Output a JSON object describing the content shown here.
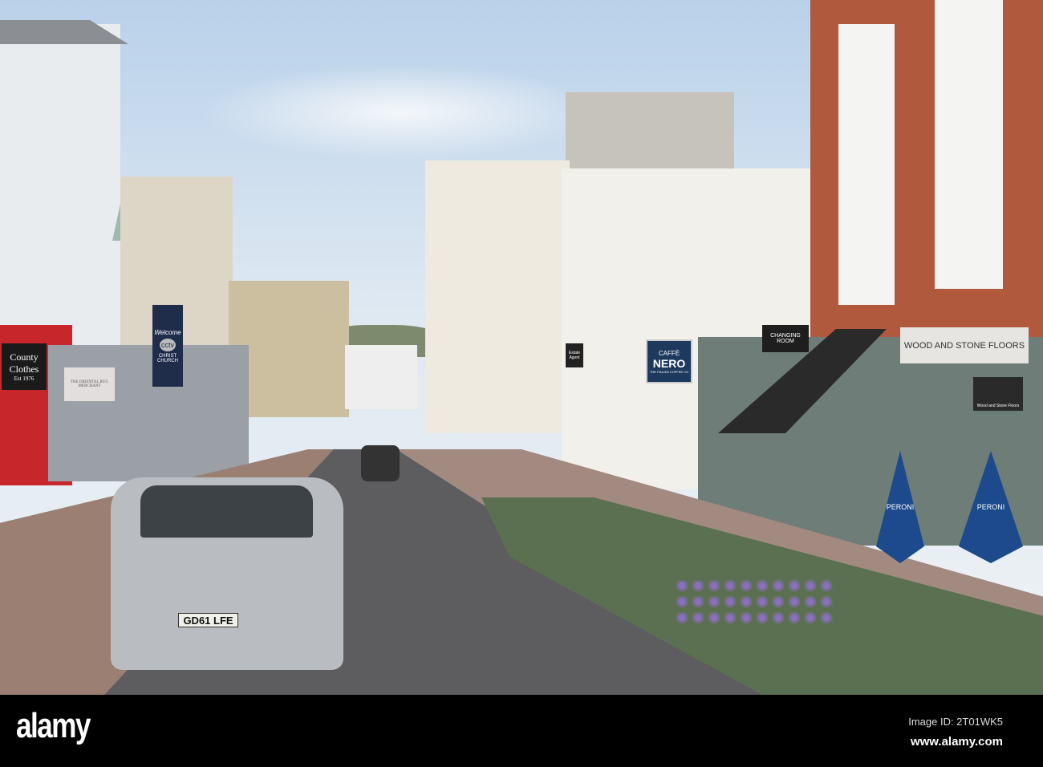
{
  "signs": {
    "county_clothes": [
      "County",
      "Clothes",
      "Est 1976"
    ],
    "banner": [
      "Welcome",
      "cctv",
      "CHRIST",
      "CHURCH"
    ],
    "rug_merchant": "THE ORIENTAL RUG MERCHANT",
    "caffe_nero": [
      "CAFFÈ",
      "NERO",
      "THE ITALIAN COFFEE CO"
    ],
    "changing_room": "CHANGING ROOM",
    "wood_stone": "WOOD AND STONE FLOORS",
    "wood_stone_small": "Wood and Stone Floors",
    "estate_agent": "Estate Agent",
    "plate": "GD61 LFE",
    "umbrella": "PERONI"
  },
  "footer": {
    "logo": "alamy",
    "image_id": "Image ID: 2T01WK5",
    "url": "www.alamy.com"
  }
}
